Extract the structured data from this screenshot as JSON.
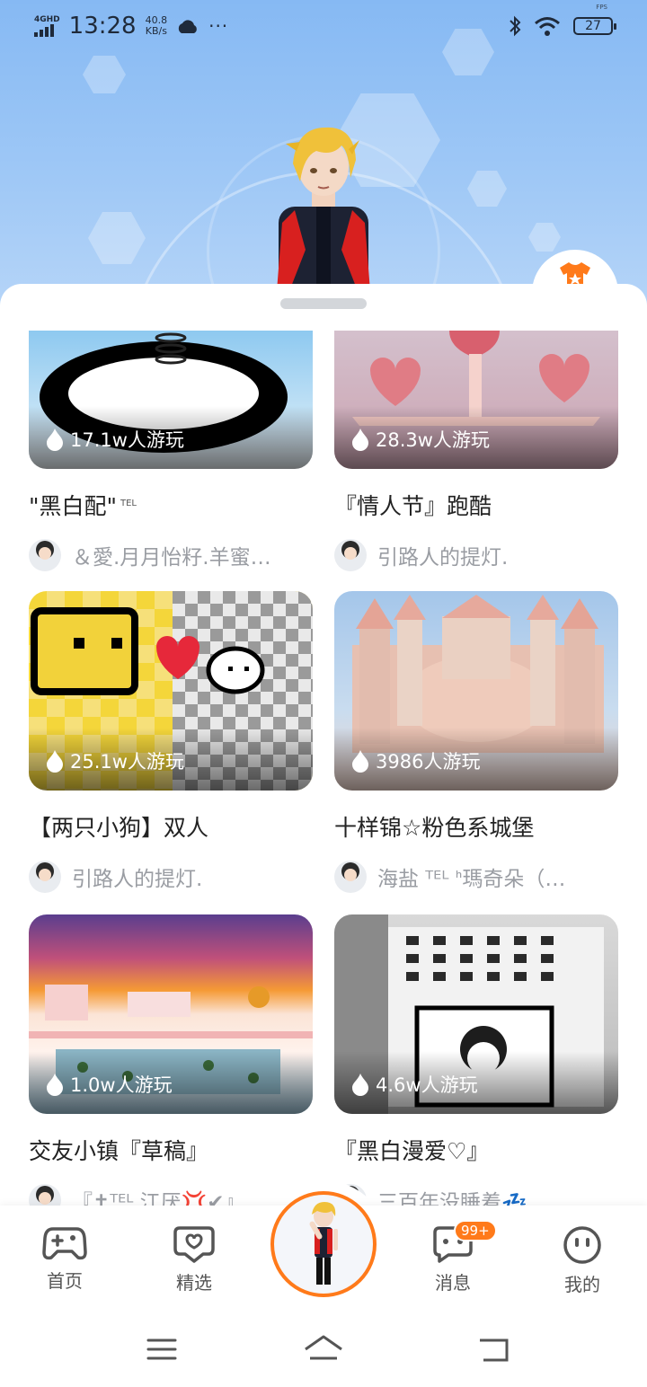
{
  "status_bar": {
    "network": "4GHD",
    "time": "13:28",
    "speed_value": "40.8",
    "speed_unit": "KB/s",
    "more": "···",
    "fps": "FPS",
    "battery": "27"
  },
  "cards": [
    {
      "title": "\"黑白配\"",
      "title_suffix": "TEL",
      "plays": "17.1w人游玩",
      "author": "＆愛.月月怡籽.羊蜜…",
      "thumb_colors": [
        "#8ec9f0",
        "#e9eef2"
      ]
    },
    {
      "title": "『情人节』跑酷",
      "title_suffix": "",
      "plays": "28.3w人游玩",
      "author": "引路人的提灯.",
      "thumb_colors": [
        "#f3b6b8",
        "#e48a8f"
      ]
    },
    {
      "title": "【两只小狗】双人",
      "title_suffix": "",
      "plays": "25.1w人游玩",
      "author": "引路人的提灯.",
      "thumb_colors": [
        "#f4d63a",
        "#cfcfcf"
      ]
    },
    {
      "title": "十样锦☆粉色系城堡",
      "title_suffix": "",
      "plays": "3986人游玩",
      "author": "海盐 ᵀᴱᴸ ᑋ瑪奇朵（…",
      "thumb_colors": [
        "#a9c9ea",
        "#e9c3b3"
      ]
    },
    {
      "title": "交友小镇『草稿』",
      "title_suffix": "",
      "plays": "1.0w人游玩",
      "author": "『✝ᵀᴱᴸ 江厌💢✔』",
      "thumb_colors": [
        "#6c4c9c",
        "#f59a35"
      ]
    },
    {
      "title": "『黑白漫爱♡』",
      "title_suffix": "",
      "plays": "4.6w人游玩",
      "author": "三百年没睡着💤",
      "thumb_colors": [
        "#e6e6e6",
        "#6a6a6a"
      ]
    }
  ],
  "tabs": [
    {
      "label": "首页",
      "icon": "gamepad-icon"
    },
    {
      "label": "精选",
      "icon": "heart-chat-icon"
    },
    {
      "label": "消息",
      "icon": "message-icon",
      "badge": "99+"
    },
    {
      "label": "我的",
      "icon": "smile-face-icon"
    }
  ],
  "colors": {
    "accent": "#ff7a1a",
    "hero_top": "#86b9f3",
    "text_primary": "#222222",
    "text_secondary": "#9a9da3"
  }
}
